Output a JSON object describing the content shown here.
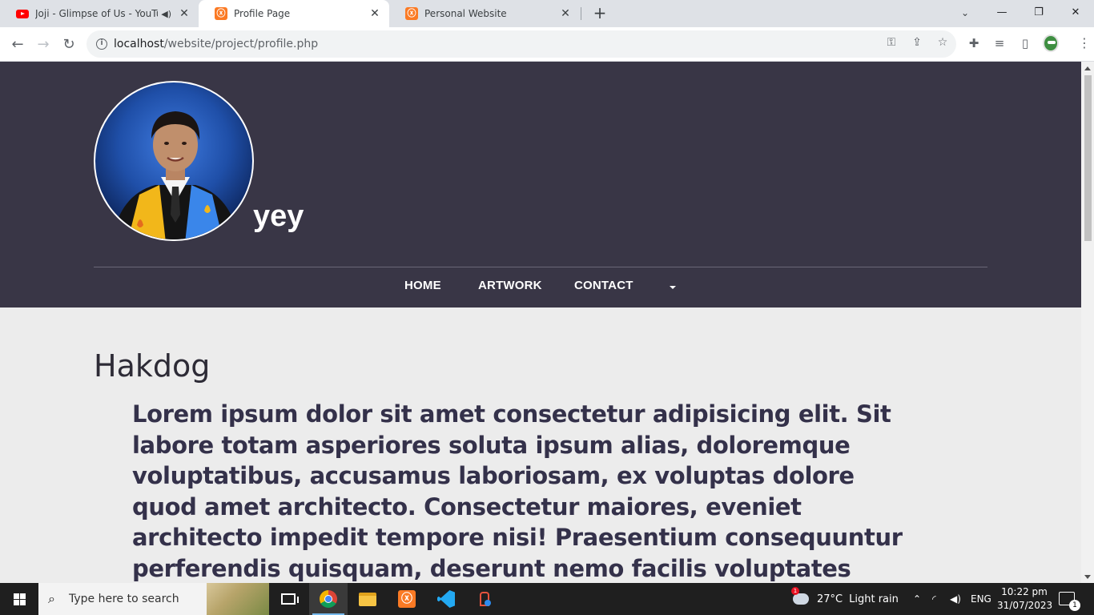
{
  "browser": {
    "tabs": [
      {
        "title": "Joji - Glimpse of Us - YouTube",
        "icon": "youtube-icon",
        "audio": true,
        "active": false
      },
      {
        "title": "Profile Page",
        "icon": "xampp-icon",
        "active": true
      },
      {
        "title": "Personal Website",
        "icon": "xampp-icon",
        "active": false
      }
    ],
    "new_tab": "+",
    "address": {
      "host": "localhost",
      "path": "/website/project/profile.php"
    }
  },
  "page": {
    "site_name": "yey",
    "nav": {
      "items": [
        "HOME",
        "ARTWORK",
        "CONTACT"
      ]
    },
    "content": {
      "title": "Hakdog",
      "body": "Lorem ipsum dolor sit amet consectetur adipisicing elit. Sit labore totam asperiores soluta ipsum alias, doloremque voluptatibus, accusamus laboriosam, ex voluptas dolore quod amet architecto. Consectetur maiores, eveniet architecto impedit tempore nisi! Praesentium consequuntur perferendis quisquam, deserunt nemo facilis voluptates labore maxime consequatur. Voluptate odio alias"
    },
    "colors": {
      "header_bg": "#393646",
      "page_bg": "#ececec",
      "text": "#34314a"
    }
  },
  "taskbar": {
    "search_placeholder": "Type here to search",
    "apps": [
      "chrome-icon",
      "file-explorer-icon",
      "xampp-icon",
      "vscode-icon",
      "paint-icon"
    ],
    "weather": {
      "temp": "27°C",
      "condition": "Light rain",
      "badge": "1"
    },
    "language": "ENG",
    "time": "10:22 pm",
    "date": "31/07/2023",
    "notifications": "1"
  }
}
